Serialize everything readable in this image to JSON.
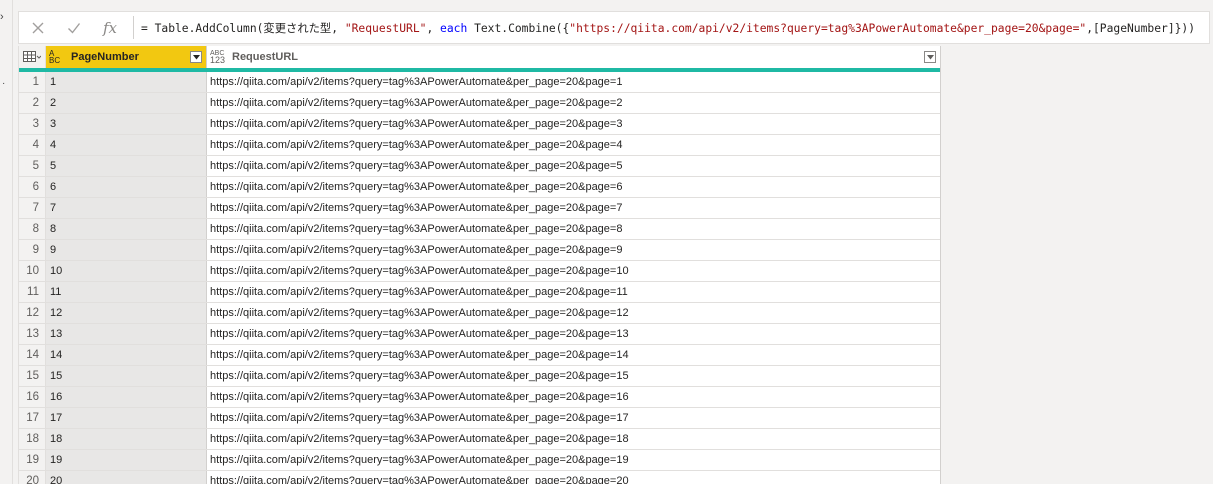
{
  "formula": {
    "prefix": "= Table.AddColumn(変更された型, ",
    "col_str": "\"RequestURL\"",
    "comma": ", ",
    "kw": "each",
    "func": " Text.Combine({",
    "url_str": "\"https://qiita.com/api/v2/items?query=tag%3APowerAutomate&per_page=20&page=\"",
    "suffix": ",[PageNumber]}))",
    "fx_label": "fx"
  },
  "columns": [
    {
      "name": "PageNumber",
      "type_icon": "text-type-icon",
      "type_top": "A",
      "type_bottom": "BC",
      "selected": true
    },
    {
      "name": "RequestURL",
      "type_icon": "any-type-icon",
      "type_top": "ABC",
      "type_bottom": "123",
      "selected": false
    }
  ],
  "colors": {
    "accent": "#1fb9a4",
    "selected_header": "#f2c811"
  },
  "rows": [
    {
      "n": "1",
      "page": "1",
      "url": "https://qiita.com/api/v2/items?query=tag%3APowerAutomate&per_page=20&page=1"
    },
    {
      "n": "2",
      "page": "2",
      "url": "https://qiita.com/api/v2/items?query=tag%3APowerAutomate&per_page=20&page=2"
    },
    {
      "n": "3",
      "page": "3",
      "url": "https://qiita.com/api/v2/items?query=tag%3APowerAutomate&per_page=20&page=3"
    },
    {
      "n": "4",
      "page": "4",
      "url": "https://qiita.com/api/v2/items?query=tag%3APowerAutomate&per_page=20&page=4"
    },
    {
      "n": "5",
      "page": "5",
      "url": "https://qiita.com/api/v2/items?query=tag%3APowerAutomate&per_page=20&page=5"
    },
    {
      "n": "6",
      "page": "6",
      "url": "https://qiita.com/api/v2/items?query=tag%3APowerAutomate&per_page=20&page=6"
    },
    {
      "n": "7",
      "page": "7",
      "url": "https://qiita.com/api/v2/items?query=tag%3APowerAutomate&per_page=20&page=7"
    },
    {
      "n": "8",
      "page": "8",
      "url": "https://qiita.com/api/v2/items?query=tag%3APowerAutomate&per_page=20&page=8"
    },
    {
      "n": "9",
      "page": "9",
      "url": "https://qiita.com/api/v2/items?query=tag%3APowerAutomate&per_page=20&page=9"
    },
    {
      "n": "10",
      "page": "10",
      "url": "https://qiita.com/api/v2/items?query=tag%3APowerAutomate&per_page=20&page=10"
    },
    {
      "n": "11",
      "page": "11",
      "url": "https://qiita.com/api/v2/items?query=tag%3APowerAutomate&per_page=20&page=11"
    },
    {
      "n": "12",
      "page": "12",
      "url": "https://qiita.com/api/v2/items?query=tag%3APowerAutomate&per_page=20&page=12"
    },
    {
      "n": "13",
      "page": "13",
      "url": "https://qiita.com/api/v2/items?query=tag%3APowerAutomate&per_page=20&page=13"
    },
    {
      "n": "14",
      "page": "14",
      "url": "https://qiita.com/api/v2/items?query=tag%3APowerAutomate&per_page=20&page=14"
    },
    {
      "n": "15",
      "page": "15",
      "url": "https://qiita.com/api/v2/items?query=tag%3APowerAutomate&per_page=20&page=15"
    },
    {
      "n": "16",
      "page": "16",
      "url": "https://qiita.com/api/v2/items?query=tag%3APowerAutomate&per_page=20&page=16"
    },
    {
      "n": "17",
      "page": "17",
      "url": "https://qiita.com/api/v2/items?query=tag%3APowerAutomate&per_page=20&page=17"
    },
    {
      "n": "18",
      "page": "18",
      "url": "https://qiita.com/api/v2/items?query=tag%3APowerAutomate&per_page=20&page=18"
    },
    {
      "n": "19",
      "page": "19",
      "url": "https://qiita.com/api/v2/items?query=tag%3APowerAutomate&per_page=20&page=19"
    },
    {
      "n": "20",
      "page": "20",
      "url": "https://qiita.com/api/v2/items?query=tag%3APowerAutomate&per_page=20&page=20"
    }
  ]
}
